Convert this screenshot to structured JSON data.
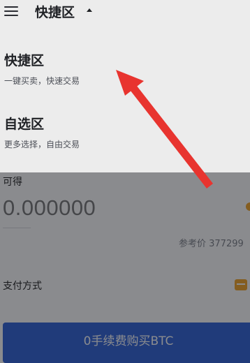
{
  "top_bar": {
    "title": "快捷区"
  },
  "dropdown": {
    "options": [
      {
        "title": "快捷区",
        "subtitle": "一键买卖，快速交易"
      },
      {
        "title": "自选区",
        "subtitle": "更多选择，自由交易"
      }
    ]
  },
  "background": {
    "available_label": "可得",
    "amount_placeholder": "0.000000",
    "reference_price": "参考价 377299",
    "payment_method_label": "支付方式",
    "buy_button_label": "0手续费购买BTC"
  },
  "colors": {
    "accent_blue": "#2a5fd6",
    "annotation_red": "#e8342f",
    "orange": "#f2a323"
  },
  "icons": [
    "menu-icon",
    "caret-up-icon",
    "card-icon"
  ]
}
